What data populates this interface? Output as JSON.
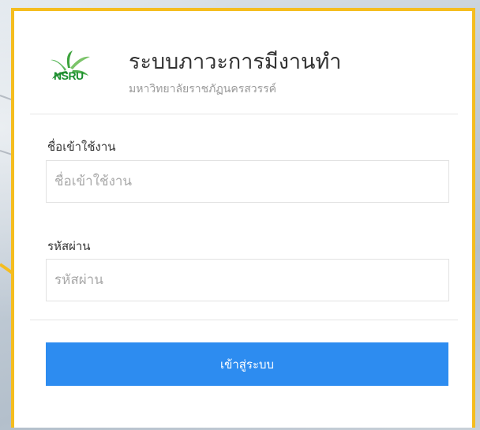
{
  "header": {
    "logo_text": "NSRU",
    "title": "ระบบภาวะการมีงานทำ",
    "subtitle": "มหาวิทยาลัยราชภัฏนครสวรรค์"
  },
  "form": {
    "username_label": "ชื่อเข้าใช้งาน",
    "username_placeholder": "ชื่อเข้าใช้งาน",
    "password_label": "รหัสผ่าน",
    "password_placeholder": "รหัสผ่าน",
    "submit_label": "เข้าสู่ระบบ"
  },
  "colors": {
    "frame_border": "#f5bd1f",
    "button_bg": "#2d8cf0",
    "logo_green": "#1a8f2e"
  }
}
